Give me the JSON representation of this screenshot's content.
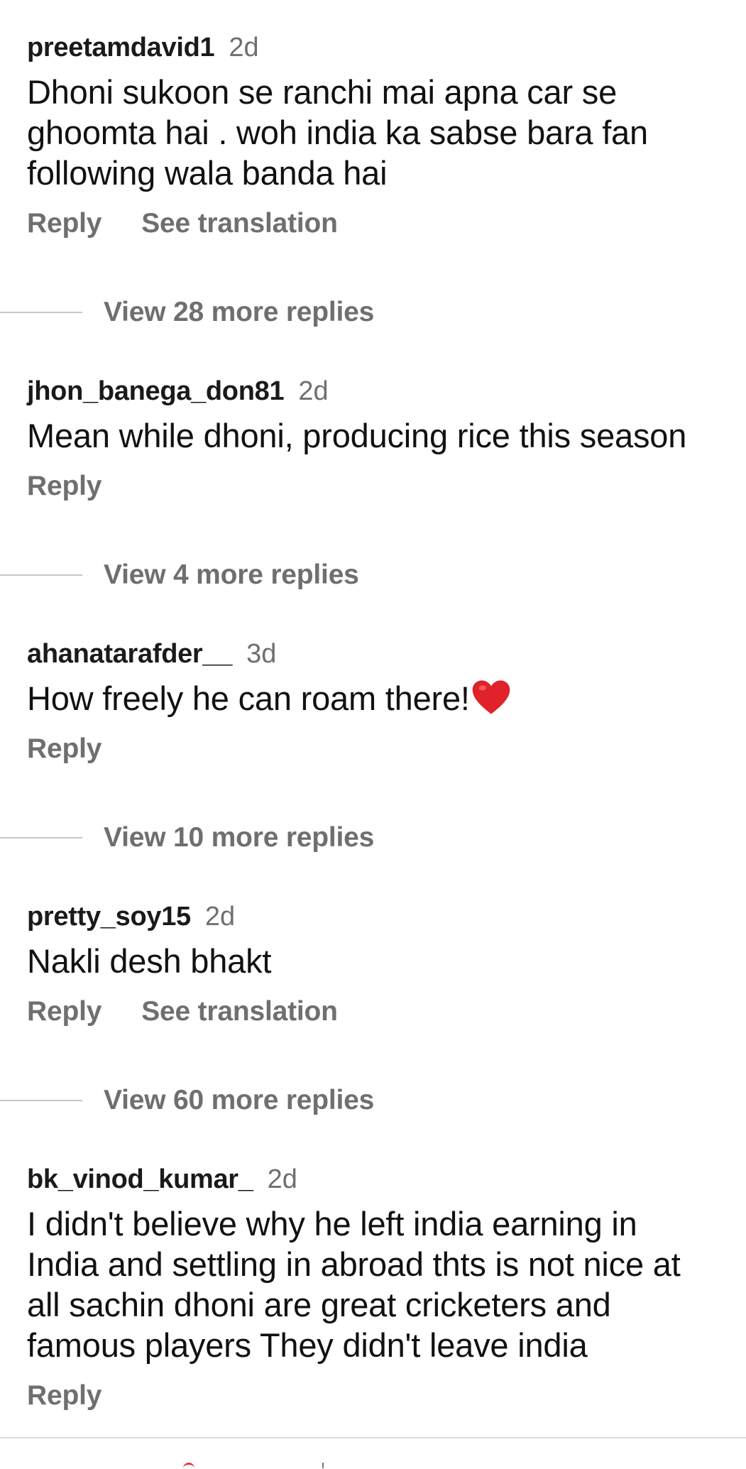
{
  "comments": [
    {
      "username": "preetamdavid1",
      "time": "2d",
      "text_lines": [
        "Dhoni sukoon se ranchi mai apna car se",
        "ghoomta hai . woh india ka sabse bara fan",
        "following wala banda hai"
      ],
      "reply_label": "Reply",
      "translate_label": "See translation",
      "view_replies": "View 28 more replies"
    },
    {
      "username": "jhon_banega_don81",
      "time": "2d",
      "text_lines": [
        "Mean while dhoni, producing rice this season"
      ],
      "reply_label": "Reply",
      "view_replies": "View 4 more replies"
    },
    {
      "username": "ahanatarafder__",
      "time": "3d",
      "text_lines": [
        "How freely he can roam there!"
      ],
      "emoji": "red-heart-icon",
      "reply_label": "Reply",
      "view_replies": "View 10 more replies"
    },
    {
      "username": "pretty_soy15",
      "time": "2d",
      "text_lines": [
        "Nakli desh bhakt"
      ],
      "reply_label": "Reply",
      "translate_label": "See translation",
      "view_replies": "View 60 more replies"
    },
    {
      "username": "bk_vinod_kumar_",
      "time": "2d",
      "text_lines": [
        "I didn't believe why he left india earning in",
        "India and settling in abroad thts is not nice at",
        "all sachin dhoni are great cricketers and",
        "famous players They didn't leave india"
      ],
      "reply_label": "Reply"
    }
  ],
  "colors": {
    "text": "#111111",
    "secondary": "#6f6f6f",
    "divider": "#c7c7c7",
    "heart": "#e0222b"
  }
}
